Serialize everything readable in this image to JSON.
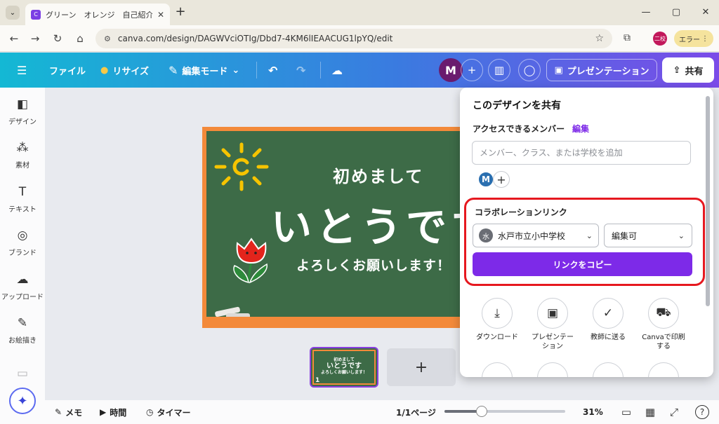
{
  "browser": {
    "tab_title": "グリーン　オレンジ　自己紹介　シ",
    "url": "canva.com/design/DAGWVciOTIg/Dbd7-4KM6lIEAACUG1lpYQ/edit",
    "profile_initials": "二校",
    "error_label": "エラー"
  },
  "topbar": {
    "file_label": "ファイル",
    "resize_label": "リサイズ",
    "edit_mode_label": "編集モード",
    "avatar_initial": "M",
    "present_label": "プレゼンテーション",
    "share_label": "共有"
  },
  "sidebar": {
    "items": [
      {
        "label": "デザイン",
        "icon": "design-icon"
      },
      {
        "label": "素材",
        "icon": "elements-icon"
      },
      {
        "label": "テキスト",
        "icon": "text-icon"
      },
      {
        "label": "ブランド",
        "icon": "brand-icon"
      },
      {
        "label": "アップロード",
        "icon": "upload-icon"
      },
      {
        "label": "お絵描き",
        "icon": "draw-icon"
      }
    ]
  },
  "slide": {
    "greeting": "初めまして",
    "name": "いとうです",
    "closing": "よろしくお願いします！",
    "colors": {
      "board": "#3d6b47",
      "frame": "#f38a3a"
    }
  },
  "thumbnail": {
    "line1": "初めまして",
    "line2": "いとうです",
    "line3": "よろしくお願いします！",
    "page_number": "1"
  },
  "bottombar": {
    "notes_label": "メモ",
    "time_label": "時間",
    "timer_label": "タイマー",
    "page_indicator": "1/1ページ",
    "zoom_percent": "31%",
    "zoom_fraction": 0.31
  },
  "share_panel": {
    "title": "このデザインを共有",
    "access_label": "アクセスできるメンバー",
    "edit_link": "編集",
    "member_placeholder": "メンバー、クラス、または学校を追加",
    "member_initial": "M",
    "collab_title": "コラボレーションリンク",
    "school_badge": "水",
    "school_name": "水戸市立小中学校",
    "permission": "編集可",
    "copy_button": "リンクをコピー",
    "actions": [
      {
        "label": "ダウンロード",
        "icon": "download-icon"
      },
      {
        "label": "プレゼンテーション",
        "icon": "presentation-icon"
      },
      {
        "label": "教師に送る",
        "icon": "check-circle-icon"
      },
      {
        "label": "Canvaで印刷する",
        "icon": "truck-icon"
      }
    ]
  },
  "colors": {
    "accent": "#7d2ae8",
    "highlight": "#e6181f"
  }
}
